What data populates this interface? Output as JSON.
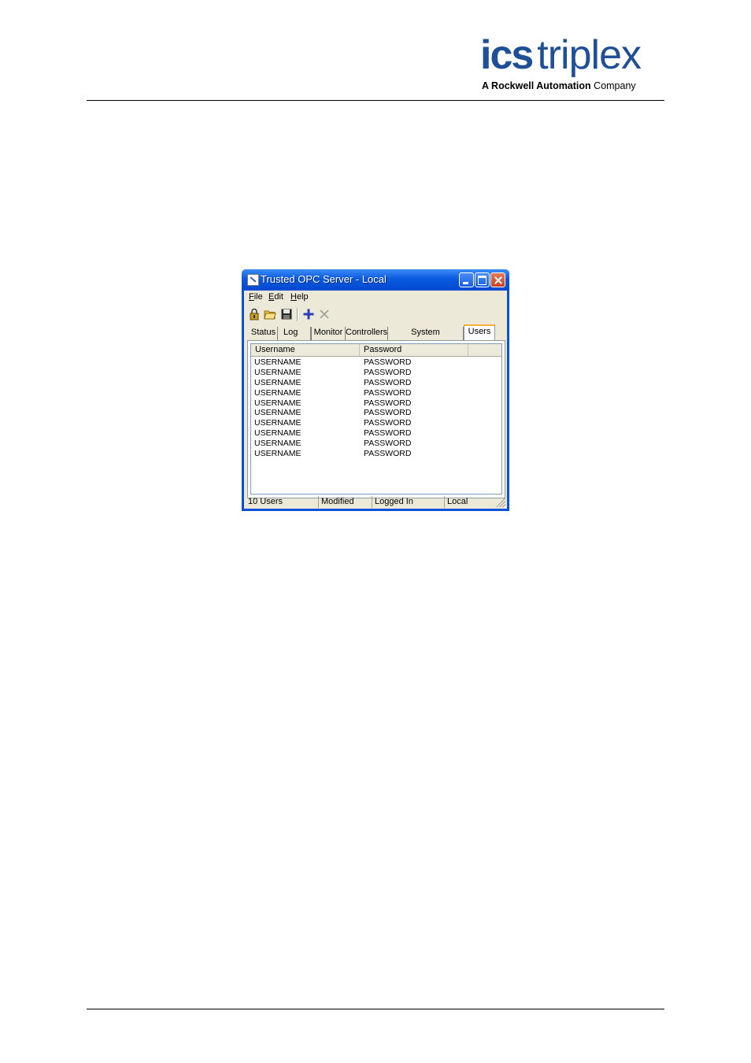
{
  "header": {
    "logo_ics": "ics",
    "logo_triplex": "triplex",
    "logo_sub_a": "A ",
    "logo_sub_brand": "Rockwell Automation",
    "logo_sub_company": " Company",
    "brand_color": "#1f4f96"
  },
  "window": {
    "title": "Trusted OPC Server - Local",
    "menu": [
      {
        "key": "F",
        "rest": "ile"
      },
      {
        "key": "E",
        "rest": "dit"
      },
      {
        "key": "H",
        "rest": "elp"
      }
    ],
    "toolbar": [
      "lock-icon",
      "open-folder-icon",
      "save-icon",
      "add-icon",
      "delete-icon"
    ],
    "tabs": [
      "Status",
      "Log",
      "Monitor",
      "Controllers",
      "System Preferences",
      "Users"
    ],
    "active_tab": "Users",
    "list": {
      "columns": [
        "Username",
        "Password",
        ""
      ],
      "rows": [
        [
          "USERNAME",
          "PASSWORD"
        ],
        [
          "USERNAME",
          "PASSWORD"
        ],
        [
          "USERNAME",
          "PASSWORD"
        ],
        [
          "USERNAME",
          "PASSWORD"
        ],
        [
          "USERNAME",
          "PASSWORD"
        ],
        [
          "USERNAME",
          "PASSWORD"
        ],
        [
          "USERNAME",
          "PASSWORD"
        ],
        [
          "USERNAME",
          "PASSWORD"
        ],
        [
          "USERNAME",
          "PASSWORD"
        ],
        [
          "USERNAME",
          "PASSWORD"
        ]
      ]
    },
    "status": [
      "10 Users",
      "Modified",
      "Logged In",
      "Local"
    ]
  }
}
